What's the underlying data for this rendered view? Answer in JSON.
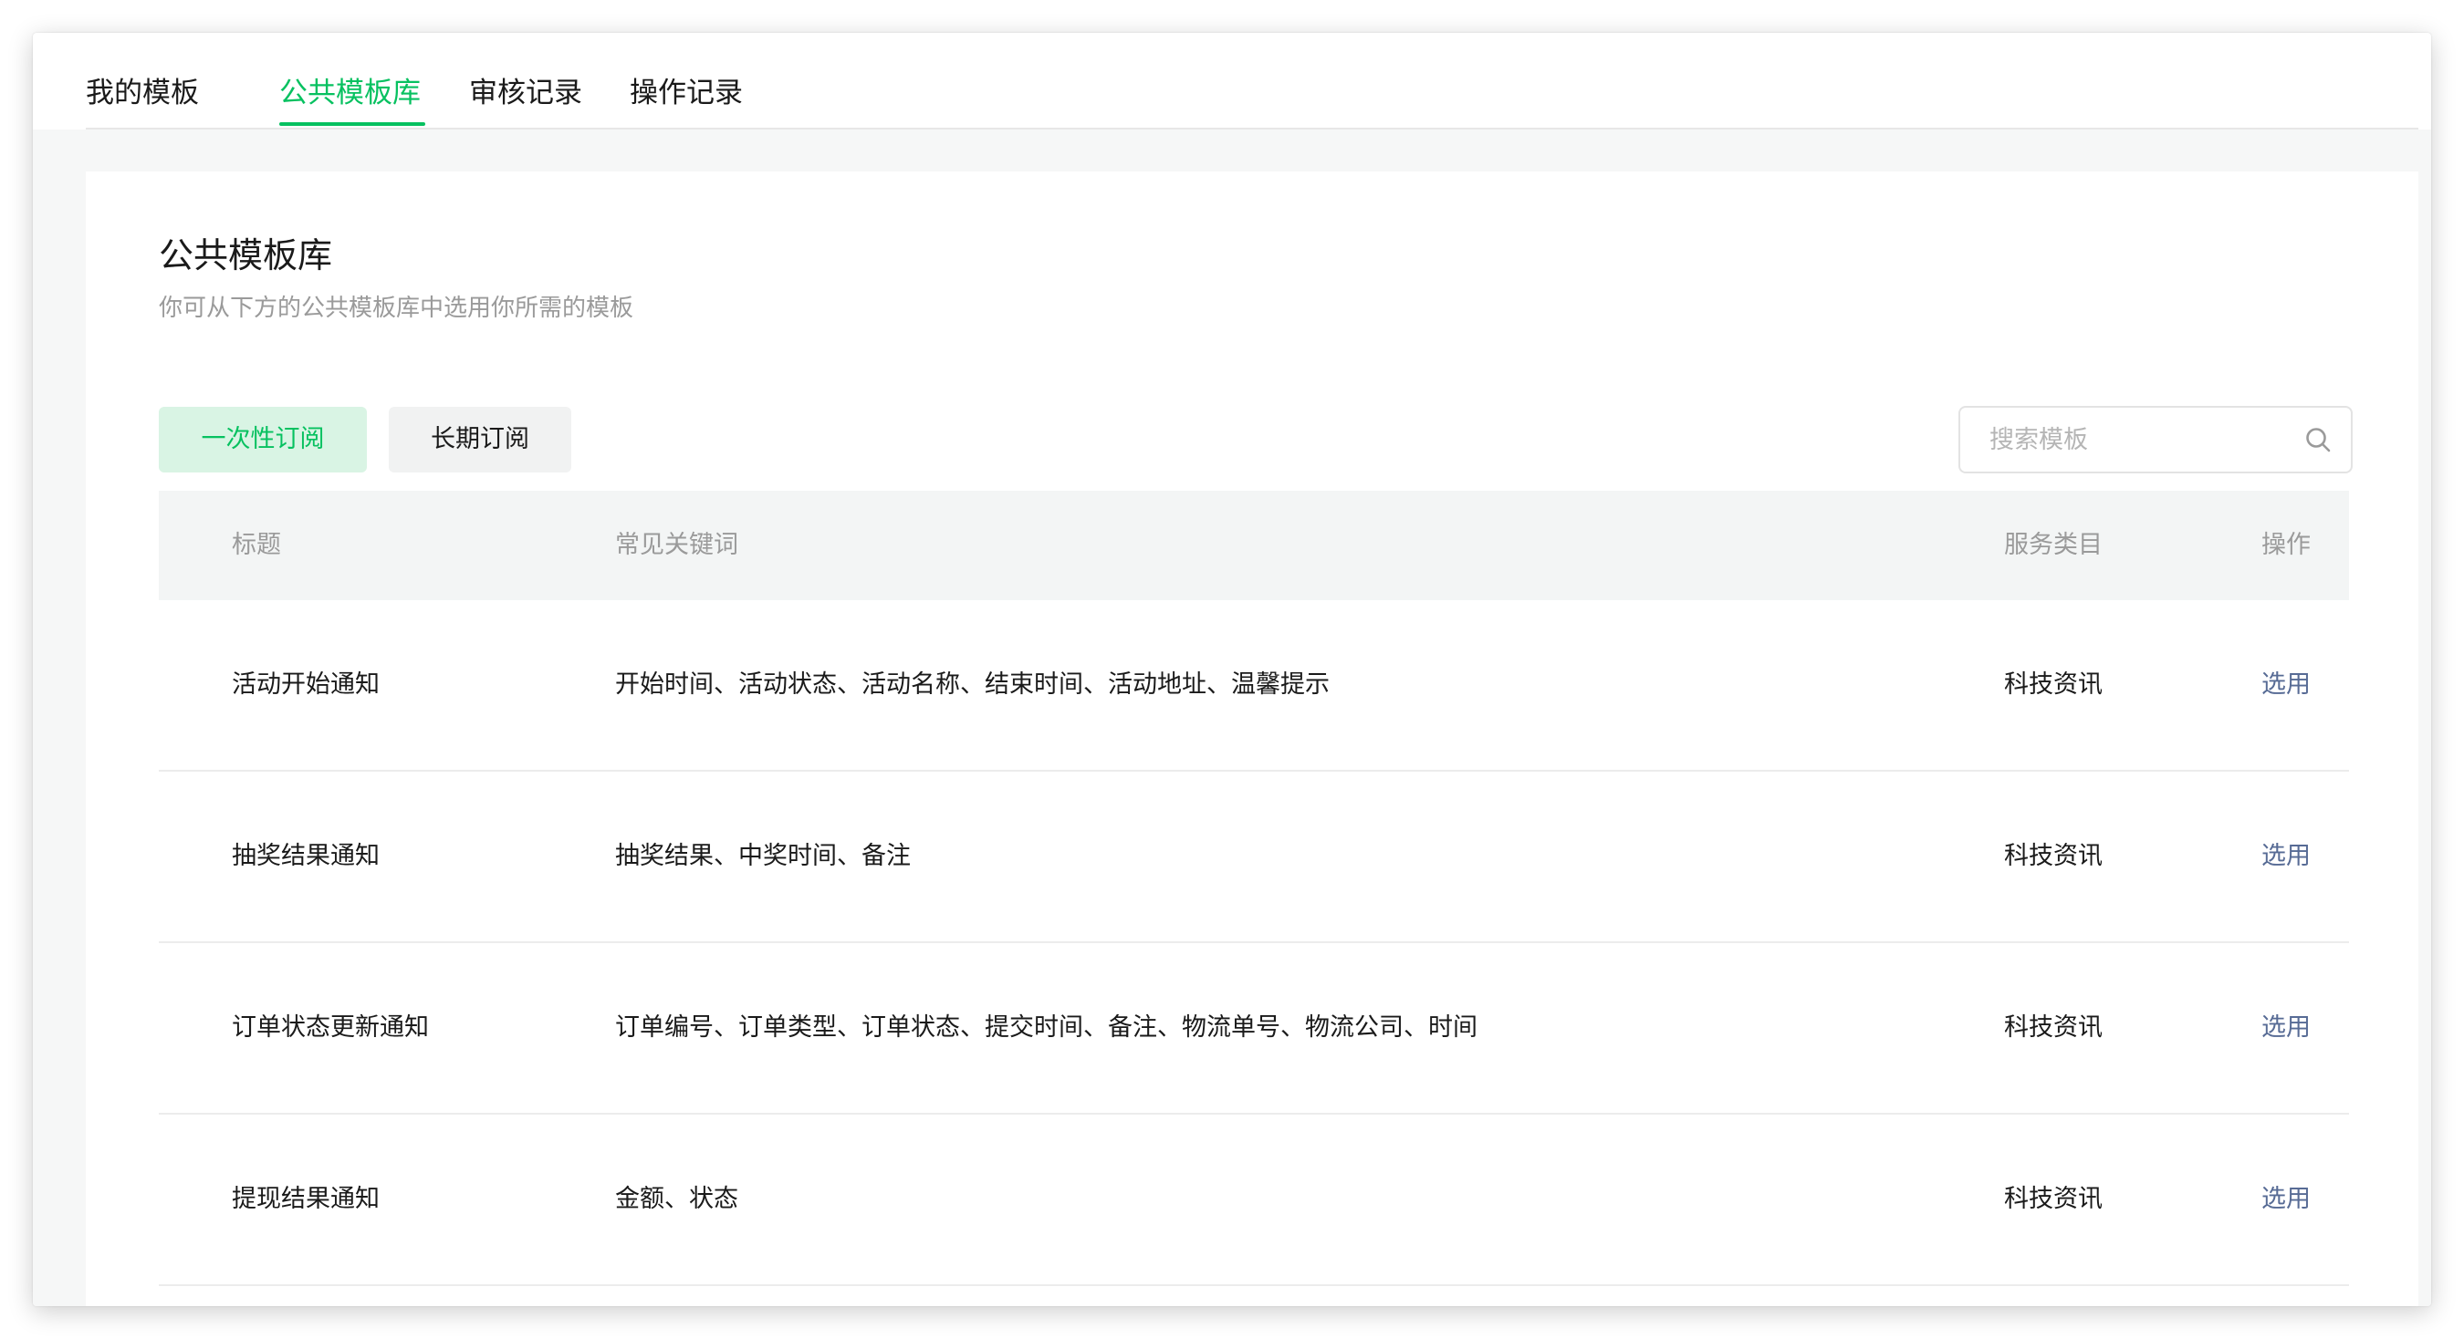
{
  "tabs": [
    {
      "label": "我的模板",
      "active": false
    },
    {
      "label": "公共模板库",
      "active": true
    },
    {
      "label": "审核记录",
      "active": false
    },
    {
      "label": "操作记录",
      "active": false
    }
  ],
  "section": {
    "title": "公共模板库",
    "description": "你可从下方的公共模板库中选用你所需的模板"
  },
  "subscription_types": [
    {
      "label": "一次性订阅",
      "active": true
    },
    {
      "label": "长期订阅",
      "active": false
    }
  ],
  "search": {
    "placeholder": "搜索模板",
    "value": "",
    "icon": "search-icon"
  },
  "table": {
    "headers": {
      "title": "标题",
      "keywords": "常见关键词",
      "category": "服务类目",
      "action": "操作"
    },
    "rows": [
      {
        "title": "活动开始通知",
        "keywords": "开始时间、活动状态、活动名称、结束时间、活动地址、温馨提示",
        "category": "科技资讯",
        "action": "选用"
      },
      {
        "title": "抽奖结果通知",
        "keywords": "抽奖结果、中奖时间、备注",
        "category": "科技资讯",
        "action": "选用"
      },
      {
        "title": "订单状态更新通知",
        "keywords": "订单编号、订单类型、订单状态、提交时间、备注、物流单号、物流公司、时间",
        "category": "科技资讯",
        "action": "选用"
      },
      {
        "title": "提现结果通知",
        "keywords": "金额、状态",
        "category": "科技资讯",
        "action": "选用"
      }
    ]
  },
  "colors": {
    "accent": "#07c160",
    "link": "#576b95",
    "muted_text": "#9a9a9a",
    "header_bg": "#f3f5f5"
  }
}
